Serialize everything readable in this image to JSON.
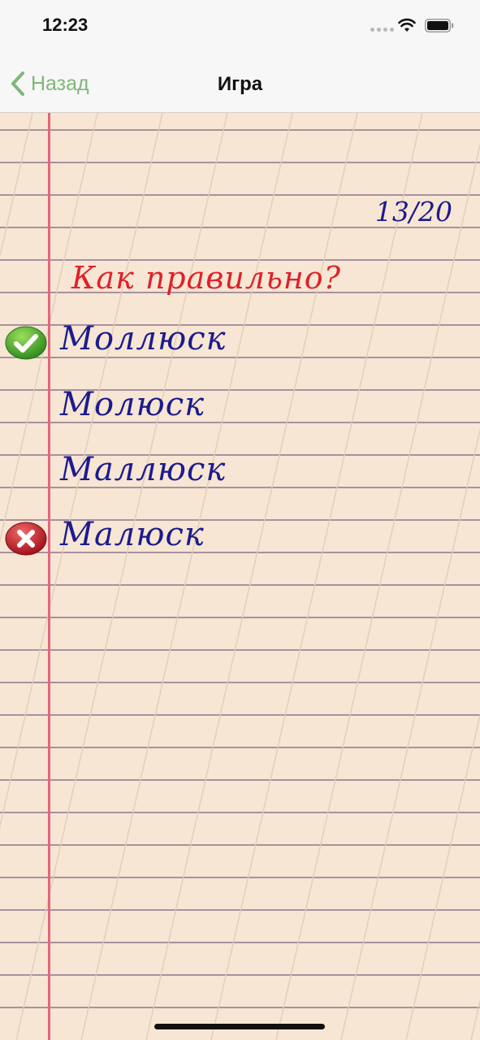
{
  "status_bar": {
    "time": "12:23"
  },
  "nav": {
    "back_label": "Назад",
    "title": "Игра",
    "accent_color": "#7fb77a"
  },
  "game": {
    "score": "13/20",
    "question": "Как правильно?",
    "answers": [
      {
        "text": "Моллюск",
        "mark": "correct-check-icon"
      },
      {
        "text": "Молюск",
        "mark": null
      },
      {
        "text": "Маллюск",
        "mark": null
      },
      {
        "text": "Малюск",
        "mark": "wrong-cross-icon"
      }
    ],
    "colors": {
      "question": "#e1202a",
      "answers": "#1c1b8e",
      "margin_line": "#e5657e",
      "paper": "#f6e6d3"
    }
  }
}
